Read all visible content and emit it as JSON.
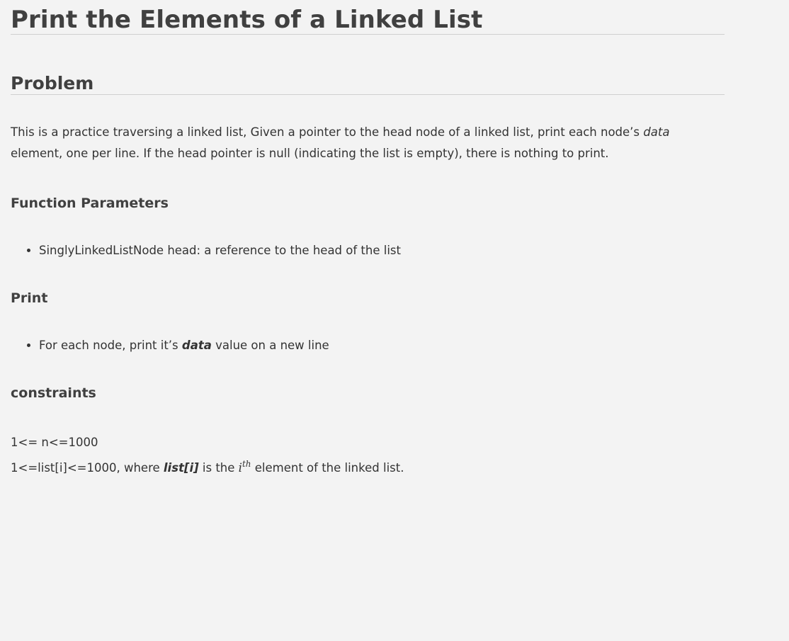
{
  "title": "Print the Elements of a Linked List",
  "problem": {
    "heading": "Problem",
    "intro_before": "This is a practice traversing a linked list, Given a pointer to the head node of a linked list, print each node’s ",
    "intro_em": "data",
    "intro_after": " element, one per line. If the head pointer is null (indicating the list is empty), there is nothing to print."
  },
  "function_parameters": {
    "heading": "Function Parameters",
    "items": [
      "SinglyLinkedListNode head: a reference to the head of the list"
    ]
  },
  "print": {
    "heading": "Print",
    "item_before": "For each node, print it’s ",
    "item_strong": "data",
    "item_after": " value on a new line"
  },
  "constraints": {
    "heading": "constraints",
    "line1": "1<= n<=1000",
    "line2_before": "1<=list[i]<=1000, where ",
    "line2_strong": "list[i]",
    "line2_mid": " is the ",
    "math_base": "i",
    "math_sup": "th",
    "line2_after": " element of the linked list."
  }
}
